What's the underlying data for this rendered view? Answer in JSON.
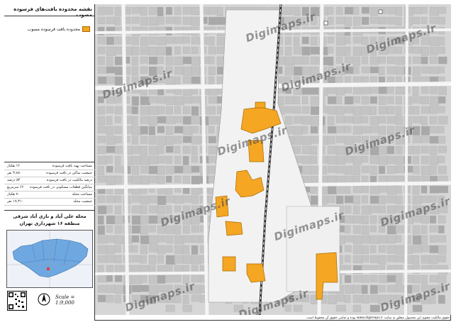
{
  "legend": {
    "title": "نقشه محدوده بافت‌های فرسوده مصوب",
    "item_label": "محدوده بافت فرسوده مصوب",
    "stats": [
      {
        "label": "مساحت پهنه بافت فرسوده",
        "value": "۱۲ هکتار"
      },
      {
        "label": "جمعیت ساکن در بافت فرسوده",
        "value": "۳,۸۸۰ نفر"
      },
      {
        "label": "درصد مالکیت در بافت فرسوده",
        "value": "۵۴ درصد"
      },
      {
        "label": "میانگین قطعات مسکونی در بافت فرسوده",
        "value": "۶۶ مترمربع"
      },
      {
        "label": "مساحت محله",
        "value": "۷۰ هکتار"
      },
      {
        "label": "جمعیت محله",
        "value": "۱۷,۳۱۰ نفر"
      }
    ],
    "region_line1": "محله علی آباد و نازی آباد شرقی",
    "region_line2": "منطقه ۱۶ شهرداری تهران",
    "scale": "Scale = 1:9,000",
    "north": "N"
  },
  "footer": "حقوق مالکیت معنوی این محصول متعلق به سایت www.digimaps.ir بوده و تمامی حقوق آن محفوظ است.",
  "watermarks": [
    "Digimaps.ir",
    "Digimaps.ir",
    "Digimaps.ir",
    "Digimaps.ir",
    "Digimaps.ir",
    "Digimaps.ir",
    "Digimaps.ir",
    "Digimaps.ir",
    "Digimaps.ir",
    "Digimaps.ir",
    "Digimaps.ir",
    "Digimaps.ir"
  ],
  "colors": {
    "zone": "#f5a623",
    "zone_stroke": "#a66b00",
    "block": "#bdbdbd",
    "street": "#f4f4f4",
    "railway": "#333333"
  }
}
